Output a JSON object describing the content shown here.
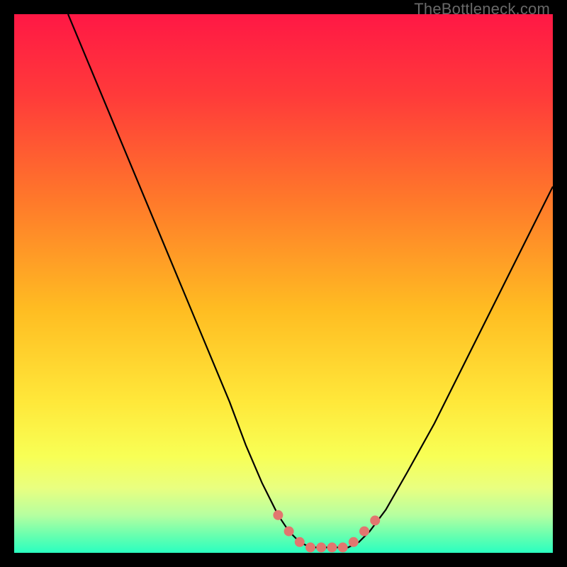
{
  "watermark": "TheBottleneck.com",
  "colors": {
    "frame_bg": "#000000",
    "curve": "#000000",
    "markers": "#e2766f",
    "gradient_stops": [
      {
        "offset": 0.0,
        "color": "#ff1845"
      },
      {
        "offset": 0.15,
        "color": "#ff3a3a"
      },
      {
        "offset": 0.35,
        "color": "#ff7a2a"
      },
      {
        "offset": 0.55,
        "color": "#ffbd22"
      },
      {
        "offset": 0.72,
        "color": "#ffe83a"
      },
      {
        "offset": 0.82,
        "color": "#f8ff55"
      },
      {
        "offset": 0.88,
        "color": "#e9ff80"
      },
      {
        "offset": 0.93,
        "color": "#b6ffa0"
      },
      {
        "offset": 0.97,
        "color": "#63ffb0"
      },
      {
        "offset": 1.0,
        "color": "#2affc0"
      }
    ]
  },
  "chart_data": {
    "type": "line",
    "title": "",
    "xlabel": "",
    "ylabel": "",
    "xlim": [
      0,
      100
    ],
    "ylim": [
      0,
      100
    ],
    "grid": false,
    "legend": false,
    "series": [
      {
        "name": "bottleneck-curve",
        "x": [
          10,
          15,
          20,
          25,
          30,
          35,
          40,
          43,
          46,
          49,
          51,
          53,
          55,
          57,
          60,
          62,
          64,
          66,
          69,
          73,
          78,
          84,
          90,
          96,
          100
        ],
        "y": [
          100,
          88,
          76,
          64,
          52,
          40,
          28,
          20,
          13,
          7,
          4,
          2,
          1,
          1,
          1,
          1,
          2,
          4,
          8,
          15,
          24,
          36,
          48,
          60,
          68
        ]
      }
    ],
    "markers": [
      {
        "x": 49,
        "y": 7
      },
      {
        "x": 51,
        "y": 4
      },
      {
        "x": 53,
        "y": 2
      },
      {
        "x": 55,
        "y": 1
      },
      {
        "x": 57,
        "y": 1
      },
      {
        "x": 59,
        "y": 1
      },
      {
        "x": 61,
        "y": 1
      },
      {
        "x": 63,
        "y": 2
      },
      {
        "x": 65,
        "y": 4
      },
      {
        "x": 67,
        "y": 6
      }
    ]
  }
}
